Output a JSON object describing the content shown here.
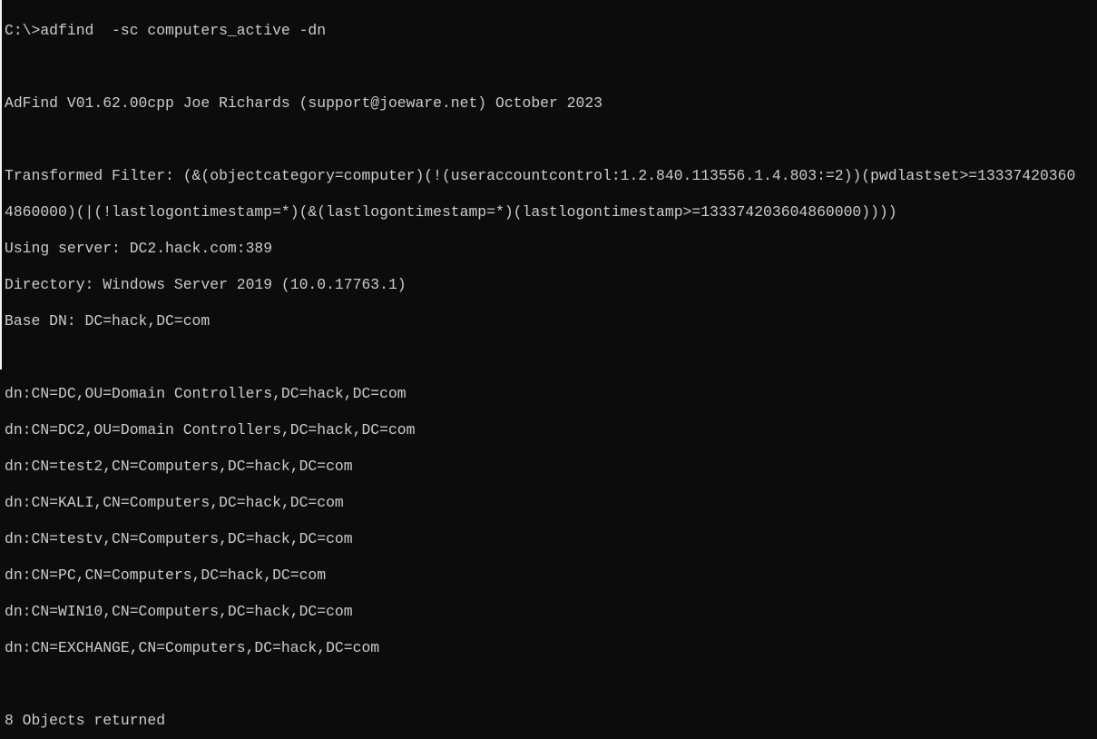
{
  "terminal": {
    "command_line": "C:\\>adfind  -sc computers_active -dn",
    "version_line": "AdFind V01.62.00cpp Joe Richards (support@joeware.net) October 2023",
    "filter_line_1": "Transformed Filter: (&(objectcategory=computer)(!(useraccountcontrol:1.2.840.113556.1.4.803:=2))(pwdlastset>=13337420360",
    "filter_line_2": "4860000)(|(!lastlogontimestamp=*)(&(lastlogontimestamp=*)(lastlogontimestamp>=133374203604860000))))",
    "server_line": "Using server: DC2.hack.com:389",
    "directory_line": "Directory: Windows Server 2019 (10.0.17763.1)",
    "basedn_line": "Base DN: DC=hack,DC=com",
    "results": [
      "dn:CN=DC,OU=Domain Controllers,DC=hack,DC=com",
      "dn:CN=DC2,OU=Domain Controllers,DC=hack,DC=com",
      "dn:CN=test2,CN=Computers,DC=hack,DC=com",
      "dn:CN=KALI,CN=Computers,DC=hack,DC=com",
      "dn:CN=testv,CN=Computers,DC=hack,DC=com",
      "dn:CN=PC,CN=Computers,DC=hack,DC=com",
      "dn:CN=WIN10,CN=Computers,DC=hack,DC=com",
      "dn:CN=EXCHANGE,CN=Computers,DC=hack,DC=com"
    ],
    "summary_line": "8 Objects returned"
  }
}
